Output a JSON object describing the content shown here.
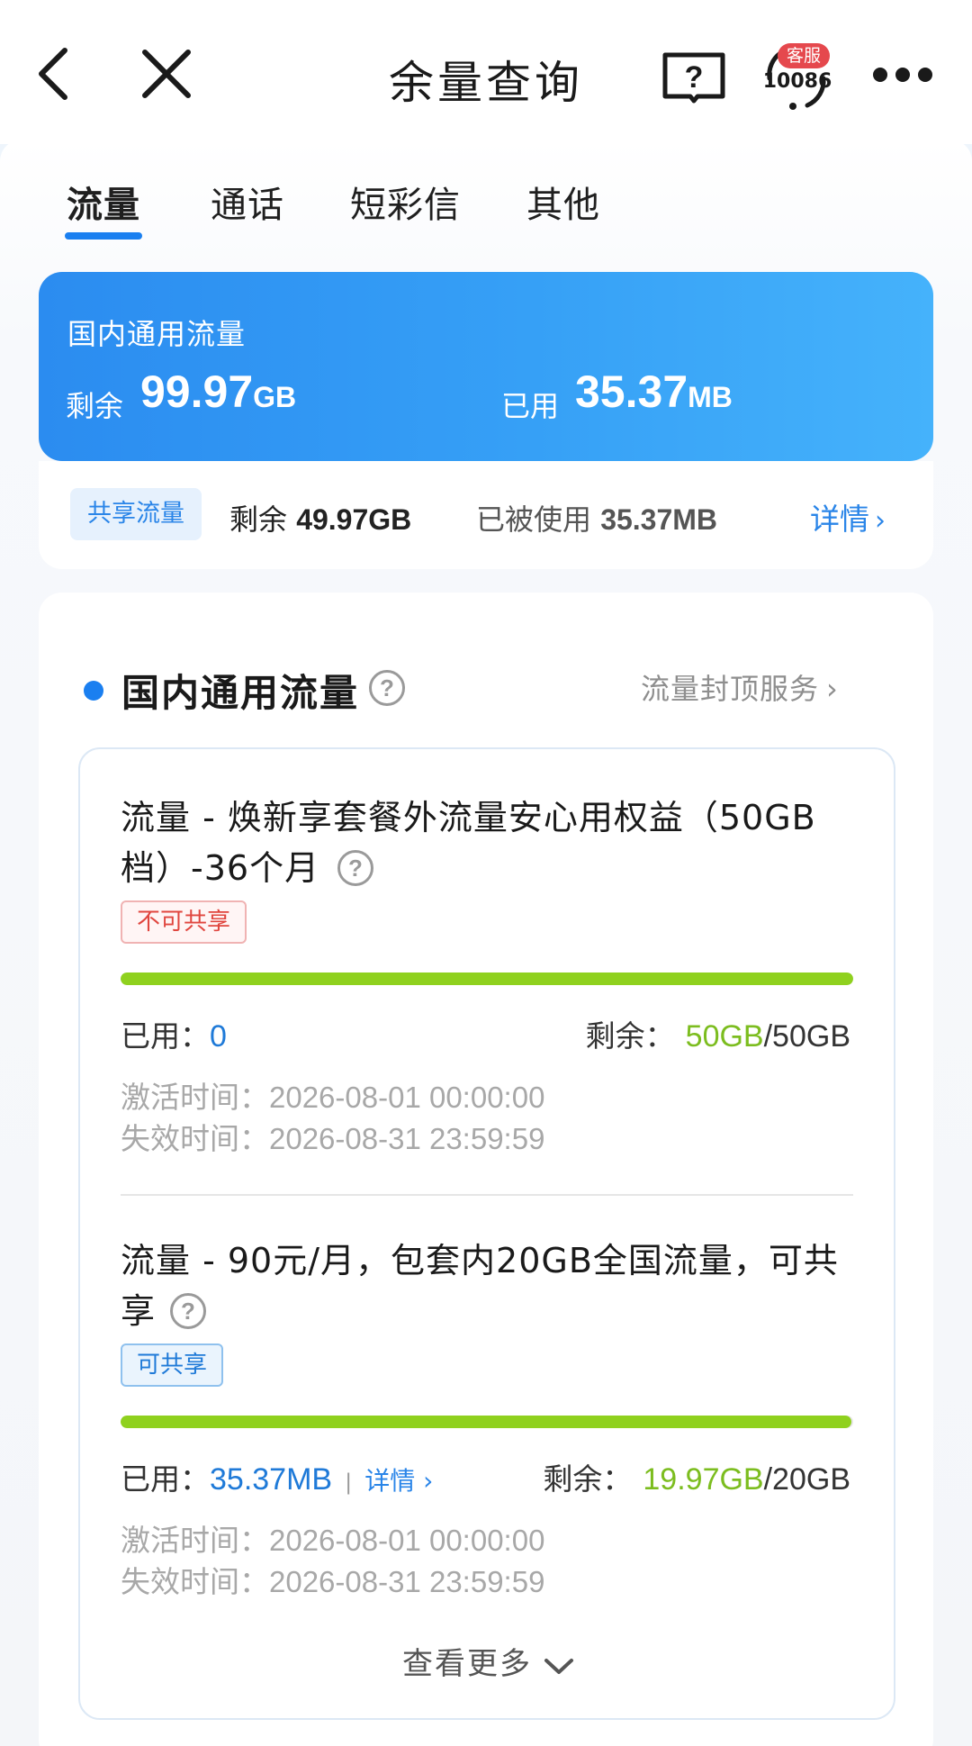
{
  "header": {
    "title": "余量查询",
    "service_badge": "客服",
    "service_number": "10086"
  },
  "tabs": [
    {
      "label": "流量",
      "active": true
    },
    {
      "label": "通话",
      "active": false
    },
    {
      "label": "短彩信",
      "active": false
    },
    {
      "label": "其他",
      "active": false
    }
  ],
  "summary": {
    "title": "国内通用流量",
    "remaining_label": "剩余",
    "remaining_value": "99.97",
    "remaining_unit": "GB",
    "used_label": "已用",
    "used_value": "35.37",
    "used_unit": "MB"
  },
  "shared": {
    "tag": "共享流量",
    "remaining_label": "剩余 ",
    "remaining_value": "49.97GB",
    "used_label": "已被使用 ",
    "used_value": "35.37MB",
    "detail": "详情"
  },
  "section": {
    "title": "国内通用流量",
    "link": "流量封顶服务"
  },
  "packages": [
    {
      "title_line1": "流量 - 焕新享套餐外流量安心用权益（50GB",
      "title_line2": "档）-36个月",
      "tag": "不可共享",
      "progress": 1.0,
      "used_label": "已用：",
      "used_value": "0",
      "remaining_label": "剩余：",
      "remaining_value": "50GB",
      "total": "/50GB",
      "activate_label": "激活时间：",
      "activate_time": "2026-08-01 00:00:00",
      "expire_label": "失效时间：",
      "expire_time": "2026-08-31 23:59:59"
    },
    {
      "title_line1": "流量 - 90元/月，包套内20GB全国流量，可共",
      "title_line2": "享",
      "tag": "可共享",
      "progress": 0.998,
      "used_label": "已用：",
      "used_value": "35.37MB",
      "used_detail": "详情",
      "remaining_label": "剩余：",
      "remaining_value": "19.97GB",
      "total": "/20GB",
      "activate_label": "激活时间：",
      "activate_time": "2026-08-01 00:00:00",
      "expire_label": "失效时间：",
      "expire_time": "2026-08-31 23:59:59"
    }
  ],
  "more": "查看更多",
  "colors": {
    "accent": "#1a7ff0",
    "progress": "#8fd11e",
    "remaining_green": "#7cbd1f",
    "tag_red": "#e0463f"
  }
}
